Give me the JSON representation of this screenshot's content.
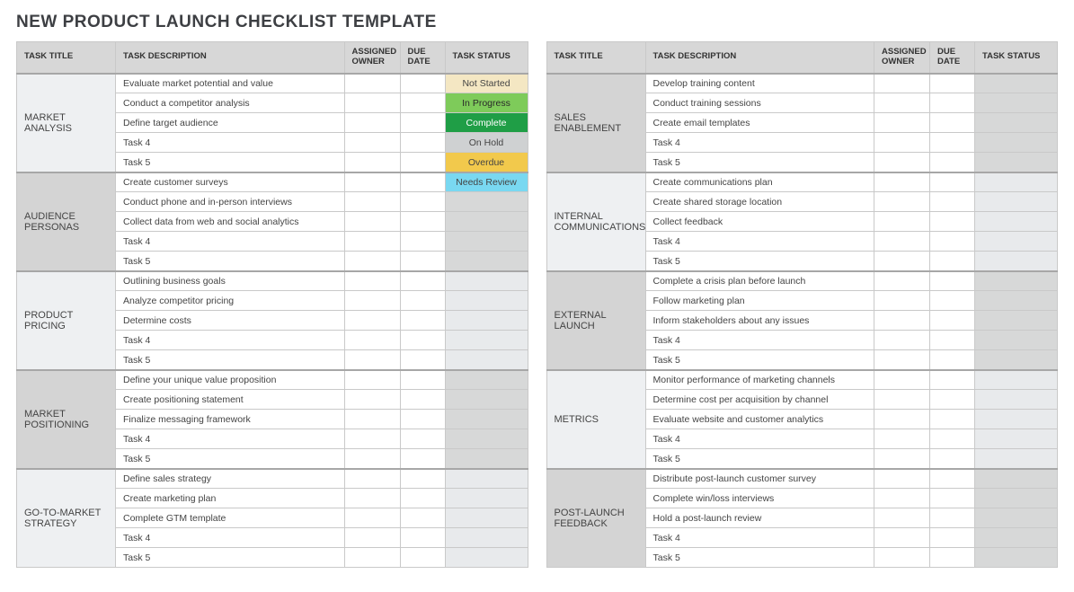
{
  "title": "NEW PRODUCT LAUNCH CHECKLIST TEMPLATE",
  "headers": {
    "title": "TASK TITLE",
    "desc": "TASK DESCRIPTION",
    "owner": "ASSIGNED OWNER",
    "due": "DUE DATE",
    "status": "TASK STATUS"
  },
  "status_labels": {
    "not_started": "Not Started",
    "in_progress": "In Progress",
    "complete": "Complete",
    "on_hold": "On Hold",
    "overdue": "Overdue",
    "needs_review": "Needs Review"
  },
  "left": [
    {
      "title": "MARKET ANALYSIS",
      "shade": "odd",
      "tasks": [
        {
          "desc": "Evaluate market potential and value",
          "status": "not_started"
        },
        {
          "desc": "Conduct a competitor analysis",
          "status": "in_progress"
        },
        {
          "desc": "Define target audience",
          "status": "complete"
        },
        {
          "desc": "Task 4",
          "status": "on_hold"
        },
        {
          "desc": "Task 5",
          "status": "overdue"
        }
      ]
    },
    {
      "title": "AUDIENCE PERSONAS",
      "shade": "even",
      "tasks": [
        {
          "desc": "Create customer surveys",
          "status": "needs_review"
        },
        {
          "desc": "Conduct phone and in-person interviews",
          "status": ""
        },
        {
          "desc": "Collect data from web and social analytics",
          "status": ""
        },
        {
          "desc": "Task 4",
          "status": ""
        },
        {
          "desc": "Task 5",
          "status": ""
        }
      ]
    },
    {
      "title": "PRODUCT PRICING",
      "shade": "odd",
      "tasks": [
        {
          "desc": "Outlining business goals",
          "status": ""
        },
        {
          "desc": "Analyze competitor pricing",
          "status": ""
        },
        {
          "desc": "Determine costs",
          "status": ""
        },
        {
          "desc": "Task 4",
          "status": ""
        },
        {
          "desc": "Task 5",
          "status": ""
        }
      ]
    },
    {
      "title": "MARKET POSITIONING",
      "shade": "even",
      "tasks": [
        {
          "desc": "Define your unique value proposition",
          "status": ""
        },
        {
          "desc": "Create positioning statement",
          "status": ""
        },
        {
          "desc": "Finalize messaging framework",
          "status": ""
        },
        {
          "desc": "Task 4",
          "status": ""
        },
        {
          "desc": "Task 5",
          "status": ""
        }
      ]
    },
    {
      "title": "GO-TO-MARKET STRATEGY",
      "shade": "odd",
      "tasks": [
        {
          "desc": "Define sales strategy",
          "status": ""
        },
        {
          "desc": "Create marketing plan",
          "status": ""
        },
        {
          "desc": "Complete GTM template",
          "status": ""
        },
        {
          "desc": "Task 4",
          "status": ""
        },
        {
          "desc": "Task 5",
          "status": ""
        }
      ]
    }
  ],
  "right": [
    {
      "title": "SALES ENABLEMENT",
      "shade": "even",
      "tasks": [
        {
          "desc": "Develop training content",
          "status": ""
        },
        {
          "desc": "Conduct training sessions",
          "status": ""
        },
        {
          "desc": "Create email templates",
          "status": ""
        },
        {
          "desc": "Task 4",
          "status": ""
        },
        {
          "desc": "Task 5",
          "status": ""
        }
      ]
    },
    {
      "title": "INTERNAL COMMUNICATIONS",
      "shade": "odd",
      "tasks": [
        {
          "desc": "Create communications plan",
          "status": ""
        },
        {
          "desc": "Create shared storage location",
          "status": ""
        },
        {
          "desc": "Collect feedback",
          "status": ""
        },
        {
          "desc": "Task 4",
          "status": ""
        },
        {
          "desc": "Task 5",
          "status": ""
        }
      ]
    },
    {
      "title": "EXTERNAL LAUNCH",
      "shade": "even",
      "tasks": [
        {
          "desc": "Complete a crisis plan before launch",
          "status": ""
        },
        {
          "desc": "Follow marketing plan",
          "status": ""
        },
        {
          "desc": "Inform stakeholders about any issues",
          "status": ""
        },
        {
          "desc": "Task 4",
          "status": ""
        },
        {
          "desc": "Task 5",
          "status": ""
        }
      ]
    },
    {
      "title": "METRICS",
      "shade": "odd",
      "tasks": [
        {
          "desc": "Monitor performance of marketing channels",
          "status": ""
        },
        {
          "desc": "Determine cost per acquisition by channel",
          "status": ""
        },
        {
          "desc": "Evaluate website and customer analytics",
          "status": ""
        },
        {
          "desc": "Task 4",
          "status": ""
        },
        {
          "desc": "Task 5",
          "status": ""
        }
      ]
    },
    {
      "title": "POST-LAUNCH FEEDBACK",
      "shade": "even",
      "tasks": [
        {
          "desc": "Distribute post-launch customer survey",
          "status": ""
        },
        {
          "desc": "Complete win/loss interviews",
          "status": ""
        },
        {
          "desc": "Hold a post-launch review",
          "status": ""
        },
        {
          "desc": "Task 4",
          "status": ""
        },
        {
          "desc": "Task 5",
          "status": ""
        }
      ]
    }
  ]
}
